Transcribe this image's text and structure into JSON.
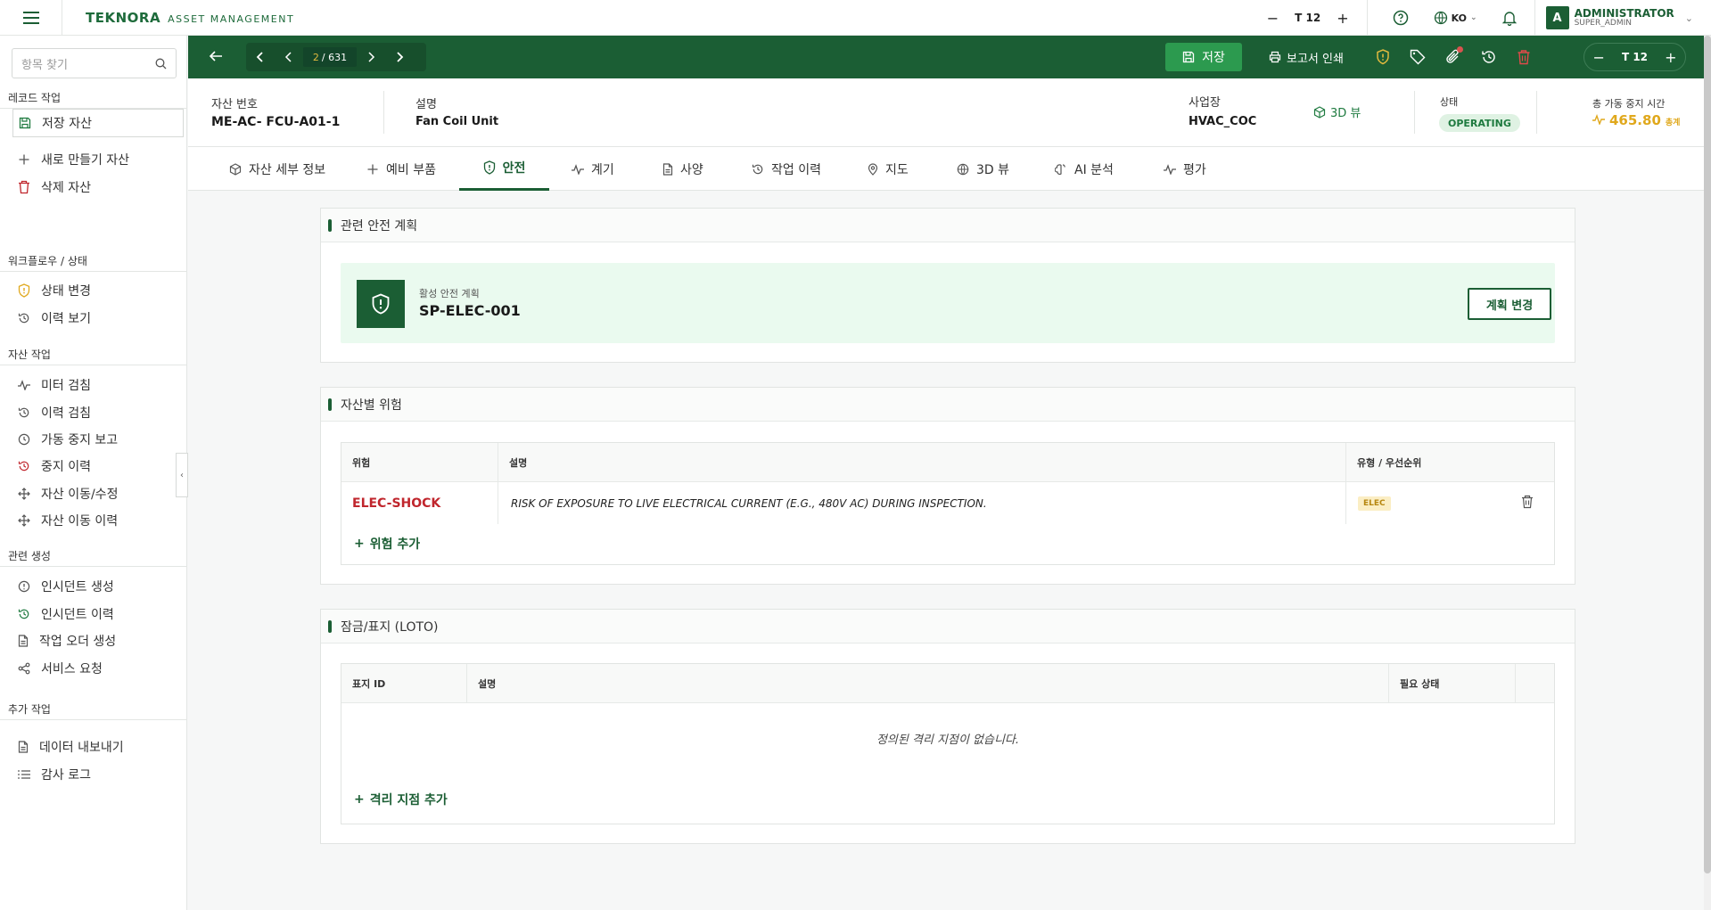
{
  "app": {
    "logo": "TEKNORA",
    "logo_sub": "ASSET MANAGEMENT"
  },
  "topbar": {
    "font_size": "12",
    "lang": "KO",
    "user_name": "ADMINISTRATOR",
    "user_role": "SUPER_ADMIN",
    "avatar": "A"
  },
  "sidebar": {
    "search_placeholder": "항목 찾기",
    "sections": [
      {
        "title": "레코드 작업",
        "items": [
          {
            "label": "저장 자산",
            "icon": "save-icon"
          },
          {
            "label": "새로 만들기 자산",
            "icon": "plus-icon"
          },
          {
            "label": "삭제 자산",
            "icon": "trash-icon"
          }
        ]
      },
      {
        "title": "워크플로우 / 상태",
        "items": [
          {
            "label": "상태 변경",
            "icon": "shield-icon"
          },
          {
            "label": "이력 보기",
            "icon": "history-icon"
          }
        ]
      },
      {
        "title": "자산 작업",
        "items": [
          {
            "label": "미터 검침",
            "icon": "pulse-icon"
          },
          {
            "label": "이력 검침",
            "icon": "history-icon"
          },
          {
            "label": "가동 중지 보고",
            "icon": "clock-icon"
          },
          {
            "label": "중지 이력",
            "icon": "history-icon"
          },
          {
            "label": "자산 이동/수정",
            "icon": "move-icon"
          },
          {
            "label": "자산 이동 이력",
            "icon": "move-icon"
          }
        ]
      },
      {
        "title": "관련 생성",
        "items": [
          {
            "label": "인시던트 생성",
            "icon": "alert-icon"
          },
          {
            "label": "인시던트 이력",
            "icon": "history-icon"
          },
          {
            "label": "작업 오더 생성",
            "icon": "document-icon"
          },
          {
            "label": "서비스 요청",
            "icon": "share-icon"
          }
        ]
      },
      {
        "title": "추가 작업",
        "items": [
          {
            "label": "데이터 내보내기",
            "icon": "document-icon"
          },
          {
            "label": "감사 로그",
            "icon": "list-icon"
          }
        ]
      }
    ]
  },
  "toolbar": {
    "page_current": "2",
    "page_total": "/ 631",
    "save_label": "저장",
    "print_label": "보고서 인쇄",
    "font_size": "12"
  },
  "header": {
    "asset_no_label": "자산 번호",
    "asset_no": "ME-AC- FCU-A01-1",
    "desc_label": "설명",
    "desc": "Fan Coil Unit",
    "site_label": "사업장",
    "site": "HVAC_COC",
    "view3d": "3D 뷰",
    "status_label": "상태",
    "status": "OPERATING",
    "downtime_label": "총 가동 중지 시간",
    "downtime": "465.80",
    "downtime_unit": "총계"
  },
  "tabs": [
    "자산 세부 정보",
    "예비 부품",
    "안전",
    "계기",
    "사양",
    "작업 이력",
    "지도",
    "3D 뷰",
    "AI 분석",
    "평가"
  ],
  "safety_plan": {
    "title": "관련 안전 계획",
    "active_label": "활성 안전 계획",
    "plan_id": "SP-ELEC-001",
    "change_btn": "계획 변경"
  },
  "hazards": {
    "title": "자산별 위험",
    "headers": [
      "위험",
      "설명",
      "유형 / 우선순위"
    ],
    "rows": [
      {
        "code": "ELEC-SHOCK",
        "desc": "RISK OF EXPOSURE TO LIVE ELECTRICAL CURRENT (E.G., 480V AC) DURING INSPECTION.",
        "type": "ELEC"
      }
    ],
    "add_label": "위험 추가"
  },
  "loto": {
    "title": "잠금/표지 (LOTO)",
    "headers": [
      "표지 ID",
      "설명",
      "필요 상태"
    ],
    "empty": "정의된 격리 지점이 없습니다.",
    "add_label": "격리 지점 추가"
  },
  "colors": {
    "brand": "#1b5e34",
    "accent_green": "#2c9a4f",
    "danger": "#c0262d",
    "warning": "#e0a81c"
  }
}
